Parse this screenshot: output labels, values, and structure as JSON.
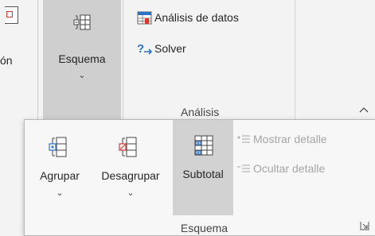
{
  "ribbon": {
    "left_fragment_label": "ón",
    "esquema_button": {
      "label": "Esquema",
      "icon": "outline-icon",
      "chevron": "⌄"
    },
    "analysis": {
      "items": [
        {
          "label": "Análisis de datos",
          "icon": "data-analysis-icon"
        },
        {
          "label": "Solver",
          "icon": "solver-icon"
        }
      ],
      "group_label": "Análisis",
      "collapse_caret": "^"
    }
  },
  "popup": {
    "buttons": [
      {
        "label": "Agrupar",
        "chevron": "⌄",
        "icon": "group-icon"
      },
      {
        "label": "Desagrupar",
        "chevron": "⌄",
        "icon": "ungroup-icon"
      },
      {
        "label": "Subtotal",
        "icon": "subtotal-icon",
        "state": "hovered"
      }
    ],
    "small_commands": [
      {
        "label": "Mostrar detalle",
        "icon": "show-detail-icon",
        "enabled": false
      },
      {
        "label": "Ocultar detalle",
        "icon": "hide-detail-icon",
        "enabled": false
      }
    ],
    "group_label": "Esquema",
    "launcher": "dialog-launcher-icon"
  },
  "colors": {
    "background": "#f3f3f3",
    "hover_bg": "#d2d2d2",
    "disabled_text": "#a6a6a6",
    "accent_blue": "#2b72c7",
    "accent_red": "#d03a32"
  }
}
